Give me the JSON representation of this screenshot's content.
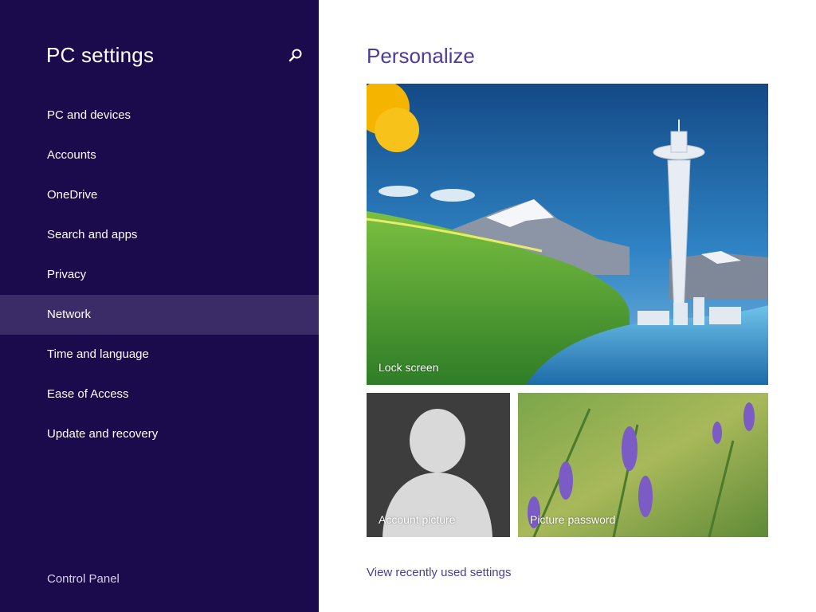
{
  "sidebar": {
    "title": "PC settings",
    "items": [
      {
        "label": "PC and devices"
      },
      {
        "label": "Accounts"
      },
      {
        "label": "OneDrive"
      },
      {
        "label": "Search and apps"
      },
      {
        "label": "Privacy"
      },
      {
        "label": "Network",
        "selected": true
      },
      {
        "label": "Time and language"
      },
      {
        "label": "Ease of Access"
      },
      {
        "label": "Update and recovery"
      }
    ],
    "control_panel": "Control Panel",
    "background_color": "#1b0a4c",
    "selected_color": "#3b2c68"
  },
  "main": {
    "title": "Personalize",
    "tiles": {
      "lock_screen": "Lock screen",
      "account_picture": "Account picture",
      "picture_password": "Picture password"
    },
    "recent_link": "View recently used settings",
    "accent_color": "#4b3d9c"
  }
}
